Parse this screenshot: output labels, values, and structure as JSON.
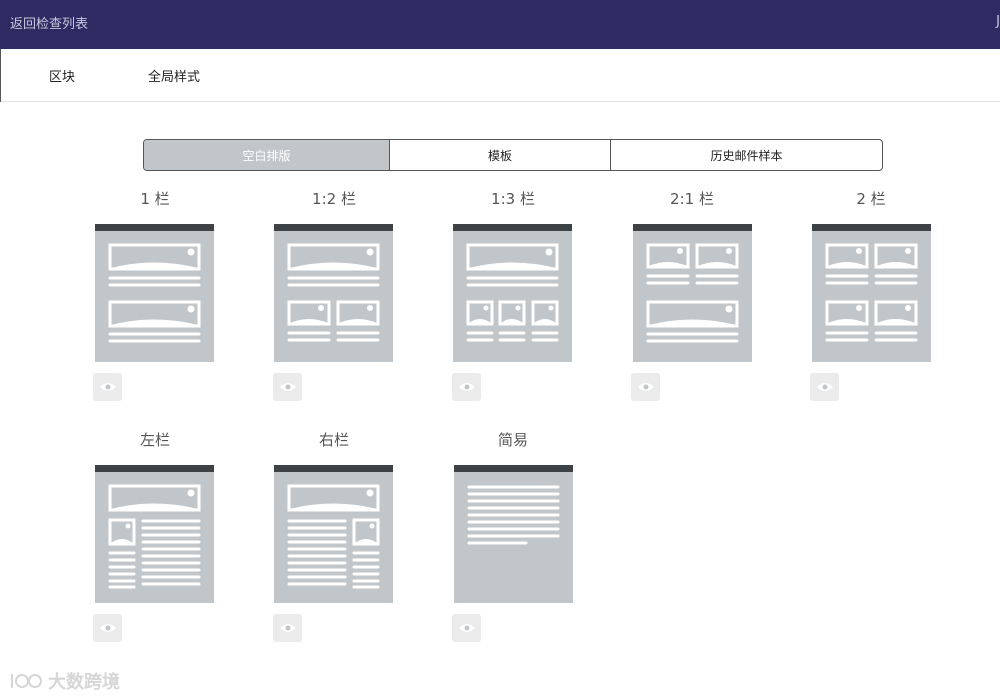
{
  "header": {
    "back_label": "返回检查列表",
    "user_initial": "J"
  },
  "subnav": {
    "items": [
      "区块",
      "全局样式"
    ]
  },
  "tabs": {
    "items": [
      "空白排版",
      "模板",
      "历史邮件样本"
    ],
    "active": 0
  },
  "layouts": [
    {
      "title": "1 栏"
    },
    {
      "title": "1:2 栏"
    },
    {
      "title": "1:3 栏"
    },
    {
      "title": "2:1 栏"
    },
    {
      "title": "2 栏"
    },
    {
      "title": "左栏"
    },
    {
      "title": "右栏"
    },
    {
      "title": "简易"
    }
  ],
  "watermark": {
    "text": "大数跨境"
  },
  "colors": {
    "header_bg": "#2d2b62",
    "thumb_bg": "#c1c6ca",
    "thumb_top": "#3d4246",
    "active_tab": "#c1c6ca"
  }
}
